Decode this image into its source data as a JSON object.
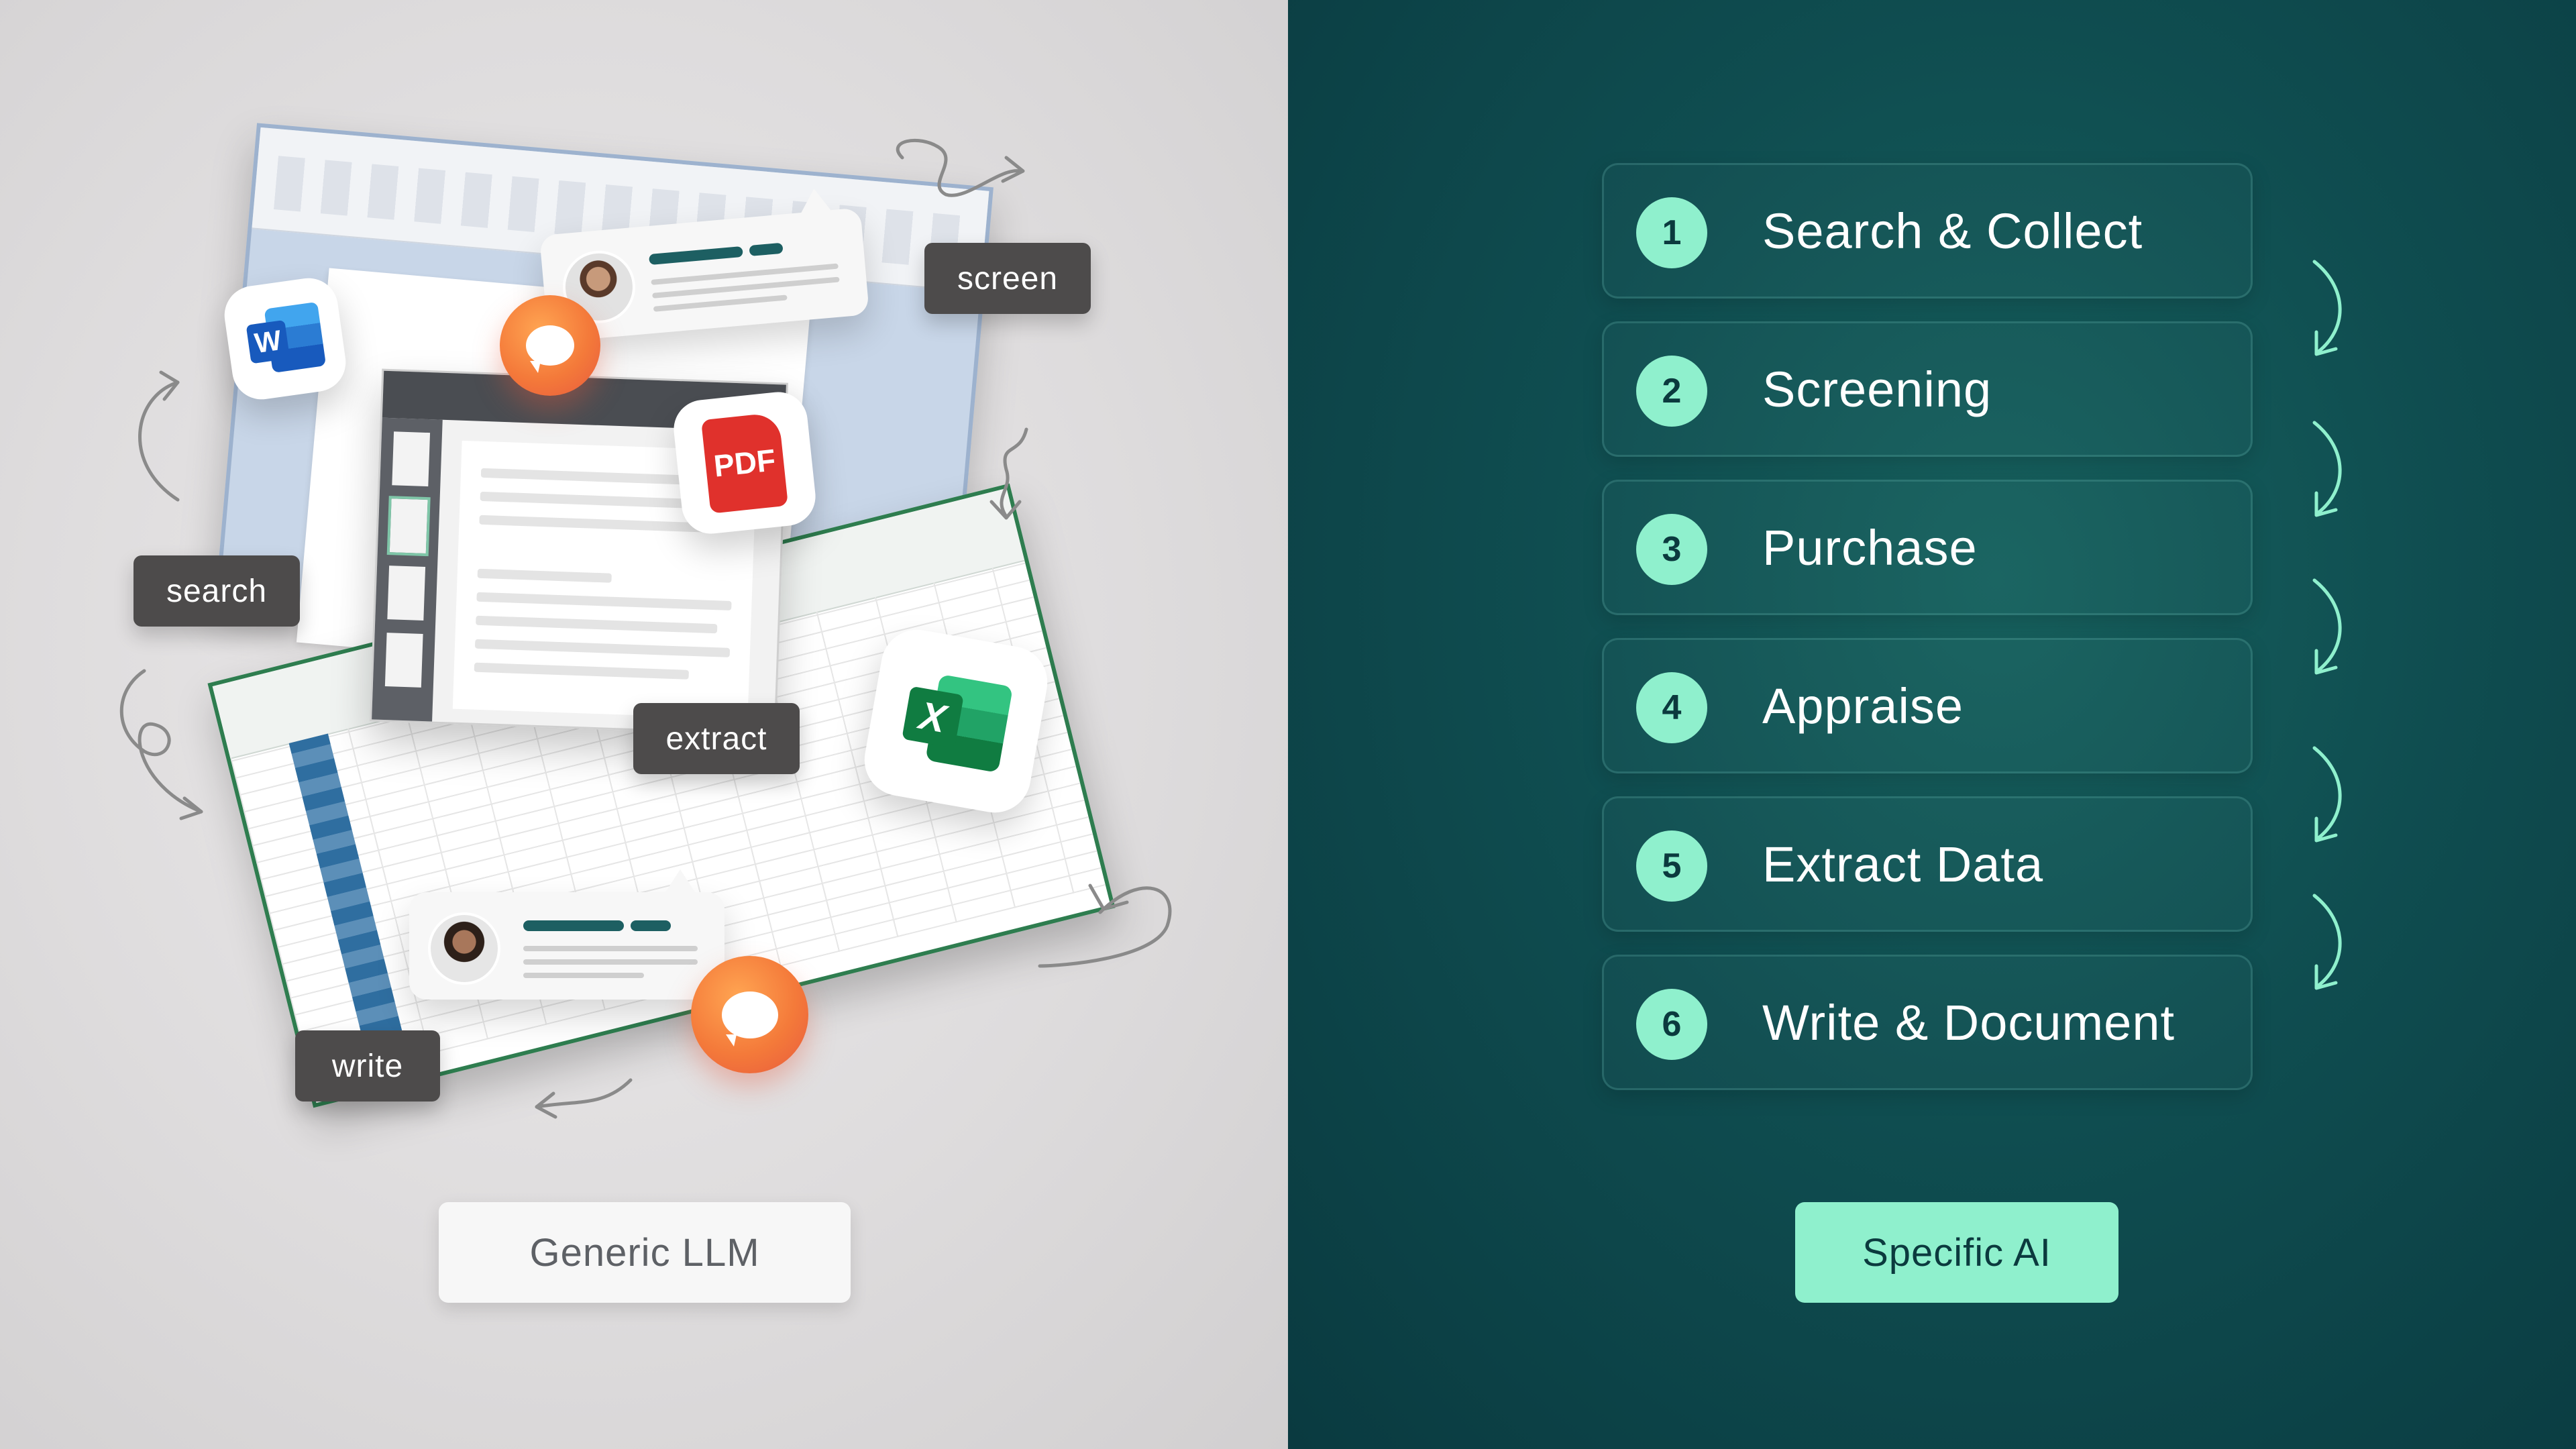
{
  "left_panel": {
    "tags": {
      "screen": "screen",
      "search": "search",
      "extract": "extract",
      "write": "write"
    },
    "icons": {
      "word_letter": "W",
      "pdf_label": "PDF",
      "excel_letter": "X"
    },
    "button_label": "Generic LLM",
    "background_color": "#dedcdd"
  },
  "right_panel": {
    "steps": [
      {
        "number": "1",
        "label": "Search & Collect"
      },
      {
        "number": "2",
        "label": "Screening"
      },
      {
        "number": "3",
        "label": "Purchase"
      },
      {
        "number": "4",
        "label": "Appraise"
      },
      {
        "number": "5",
        "label": "Extract Data"
      },
      {
        "number": "6",
        "label": "Write & Document"
      }
    ],
    "button_label": "Specific AI",
    "accent_color": "#8ff0cd",
    "background_color": "#0f4d50"
  }
}
